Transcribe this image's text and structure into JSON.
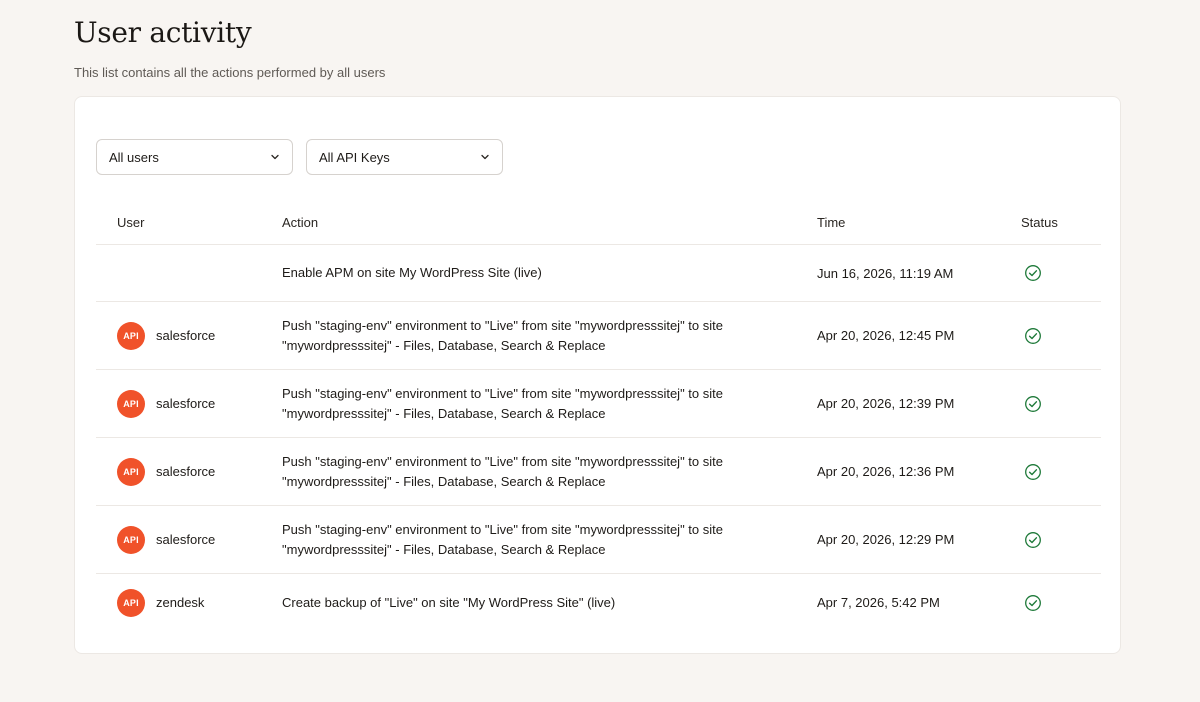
{
  "header": {
    "title": "User activity",
    "subtitle": "This list contains all the actions performed by all users"
  },
  "filters": {
    "users": {
      "selected": "All users",
      "icon": "chevron-down-icon"
    },
    "api_keys": {
      "selected": "All API Keys",
      "icon": "chevron-down-icon"
    }
  },
  "table": {
    "columns": {
      "user": "User",
      "action": "Action",
      "time": "Time",
      "status": "Status"
    },
    "rows": [
      {
        "user": "",
        "badge": "",
        "action": "Enable APM on site My WordPress Site (live)",
        "time": "Jun 16, 2026, 11:19 AM",
        "status": "success"
      },
      {
        "user": "salesforce",
        "badge": "API",
        "action": "Push \"staging-env\" environment to \"Live\" from site \"mywordpresssitej\" to site \"mywordpresssitej\" - Files, Database, Search & Replace",
        "time": "Apr 20, 2026, 12:45 PM",
        "status": "success"
      },
      {
        "user": "salesforce",
        "badge": "API",
        "action": "Push \"staging-env\" environment to \"Live\" from site \"mywordpresssitej\" to site \"mywordpresssitej\" - Files, Database, Search & Replace",
        "time": "Apr 20, 2026, 12:39 PM",
        "status": "success"
      },
      {
        "user": "salesforce",
        "badge": "API",
        "action": "Push \"staging-env\" environment to \"Live\" from site \"mywordpresssitej\" to site \"mywordpresssitej\" - Files, Database, Search & Replace",
        "time": "Apr 20, 2026, 12:36 PM",
        "status": "success"
      },
      {
        "user": "salesforce",
        "badge": "API",
        "action": "Push \"staging-env\" environment to \"Live\" from site \"mywordpresssitej\" to site \"mywordpresssitej\" - Files, Database, Search & Replace",
        "time": "Apr 20, 2026, 12:29 PM",
        "status": "success"
      },
      {
        "user": "zendesk",
        "badge": "API",
        "action": "Create backup of \"Live\" on site \"My WordPress Site\" (live)",
        "time": "Apr 7, 2026, 5:42 PM",
        "status": "success"
      }
    ]
  },
  "colors": {
    "background": "#f8f5f2",
    "card": "#ffffff",
    "badge": "#f0522a",
    "success": "#1f7a3a"
  }
}
